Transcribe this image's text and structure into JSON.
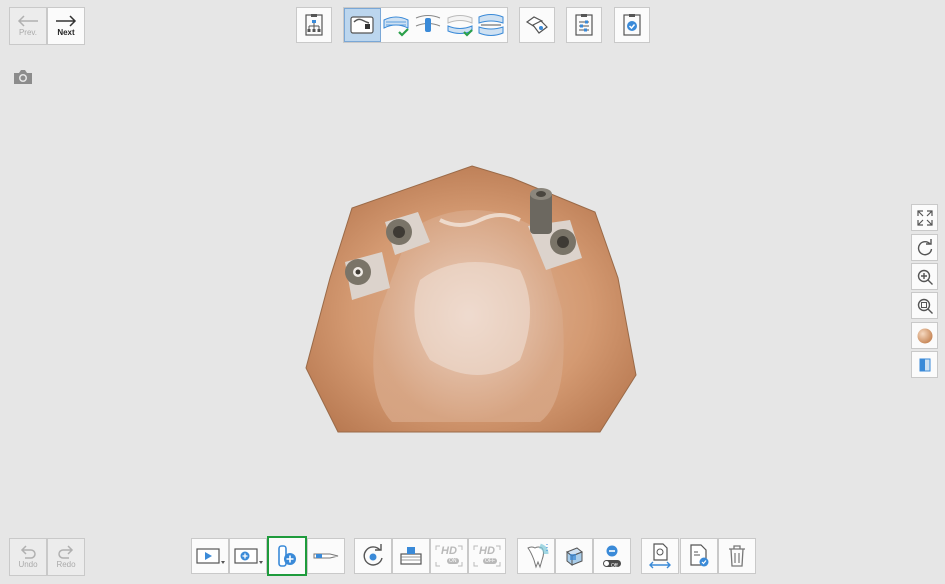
{
  "nav": {
    "prev_label": "Prev.",
    "next_label": "Next",
    "undo_label": "Undo",
    "redo_label": "Redo"
  },
  "top_toolbar": {
    "items": [
      "workflow-icon",
      "scan-stage-group",
      "tooth-scan-icon",
      "parameters-icon",
      "checklist-icon"
    ],
    "stage_group": {
      "active_index": 0,
      "stages": [
        "maxilla-scan-icon",
        "maxilla-done-icon",
        "scanbody-icon",
        "mandible-done-icon",
        "occlusion-icon"
      ]
    }
  },
  "bottom_toolbar": {
    "items": [
      "play-scan-icon",
      "scan-area-icon",
      "add-scanbody-icon",
      "scanbody-tip-icon",
      "rotate-step-icon",
      "scan-filter-icon",
      "hd-on-icon",
      "hd-off-icon",
      "tooth-mesh-icon",
      "lock-area-icon",
      "remove-off-icon",
      "transfer-data-icon",
      "report-icon",
      "trash-icon"
    ],
    "hd_label": "HD",
    "hd_on_badge": "ON",
    "hd_off_badge": "OFF",
    "remove_badge": "Off",
    "selected": "add-scanbody-icon"
  },
  "right_toolbar": {
    "items": [
      "fit-screen-icon",
      "reset-rotation-icon",
      "zoom-in-icon",
      "zoom-region-icon",
      "color-ball-icon",
      "view-mode-icon"
    ]
  },
  "colors": {
    "background": "#e6e6e6",
    "accent_blue": "#3a8ad8",
    "selected_border": "#1e9b3c",
    "model": "#d49a72"
  }
}
